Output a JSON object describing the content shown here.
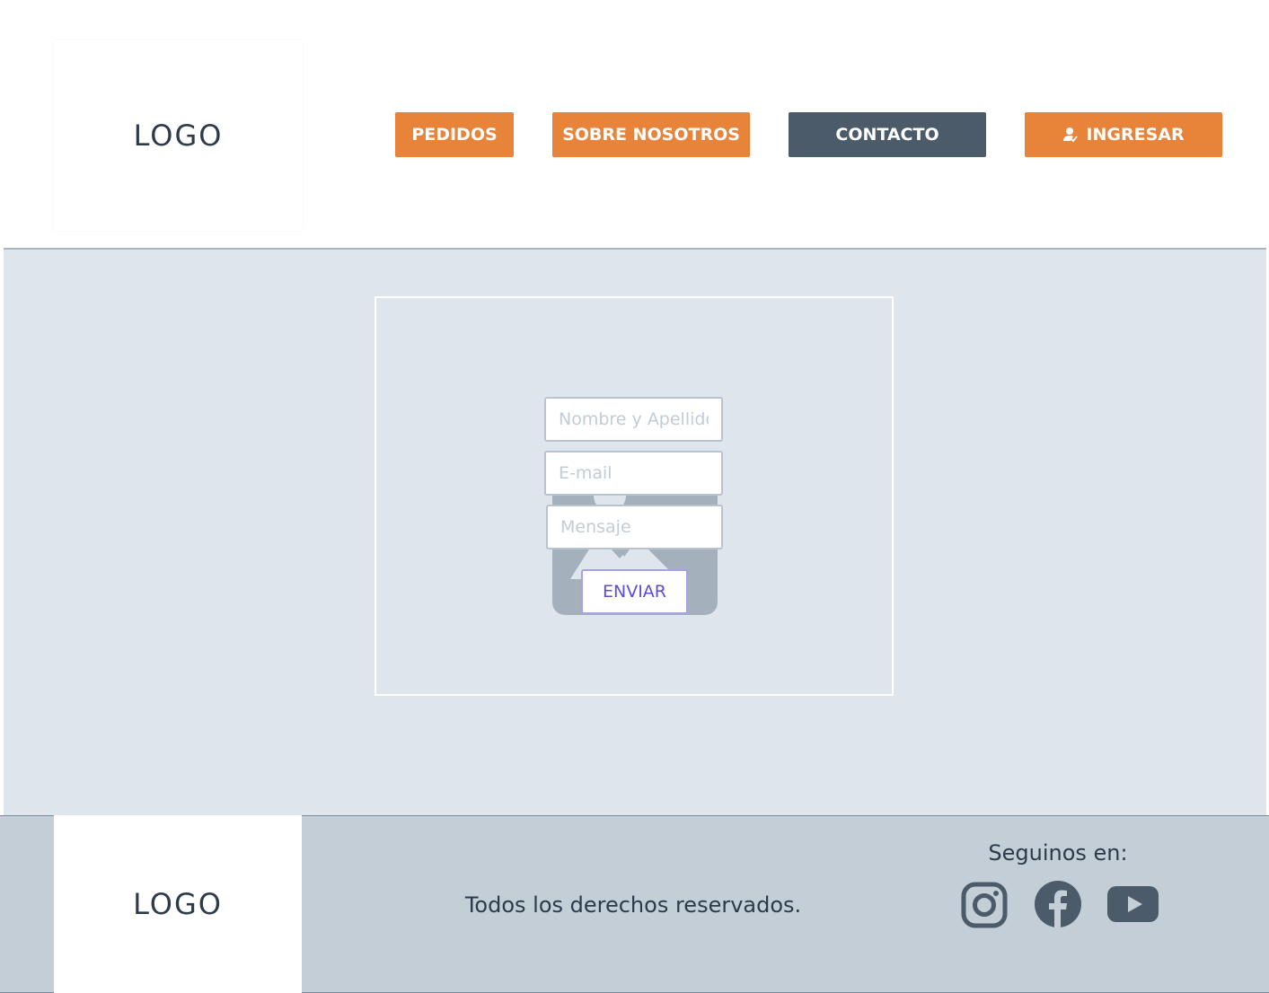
{
  "header": {
    "logo": "LOGO",
    "nav": {
      "pedidos": "PEDIDOS",
      "sobre_nosotros": "SOBRE NOSOTROS",
      "contacto": "CONTACTO",
      "ingresar": "INGRESAR"
    }
  },
  "contact_form": {
    "name_placeholder": "Nombre y Apellido",
    "email_placeholder": "E-mail",
    "message_placeholder": "Mensaje",
    "submit_label": "ENVIAR",
    "image_placeholder_icon": "image-placeholder-icon"
  },
  "footer": {
    "logo": "LOGO",
    "rights": "Todos los derechos reservados.",
    "follow_label": "Seguinos en:",
    "social_icons": [
      "instagram-icon",
      "facebook-icon",
      "youtube-icon"
    ]
  },
  "colors": {
    "accent_orange": "#e8833a",
    "active_nav": "#4b5b69",
    "main_bg": "#dfe5ed",
    "footer_bg": "#c3ced7",
    "submit_text": "#5b4fd4"
  }
}
